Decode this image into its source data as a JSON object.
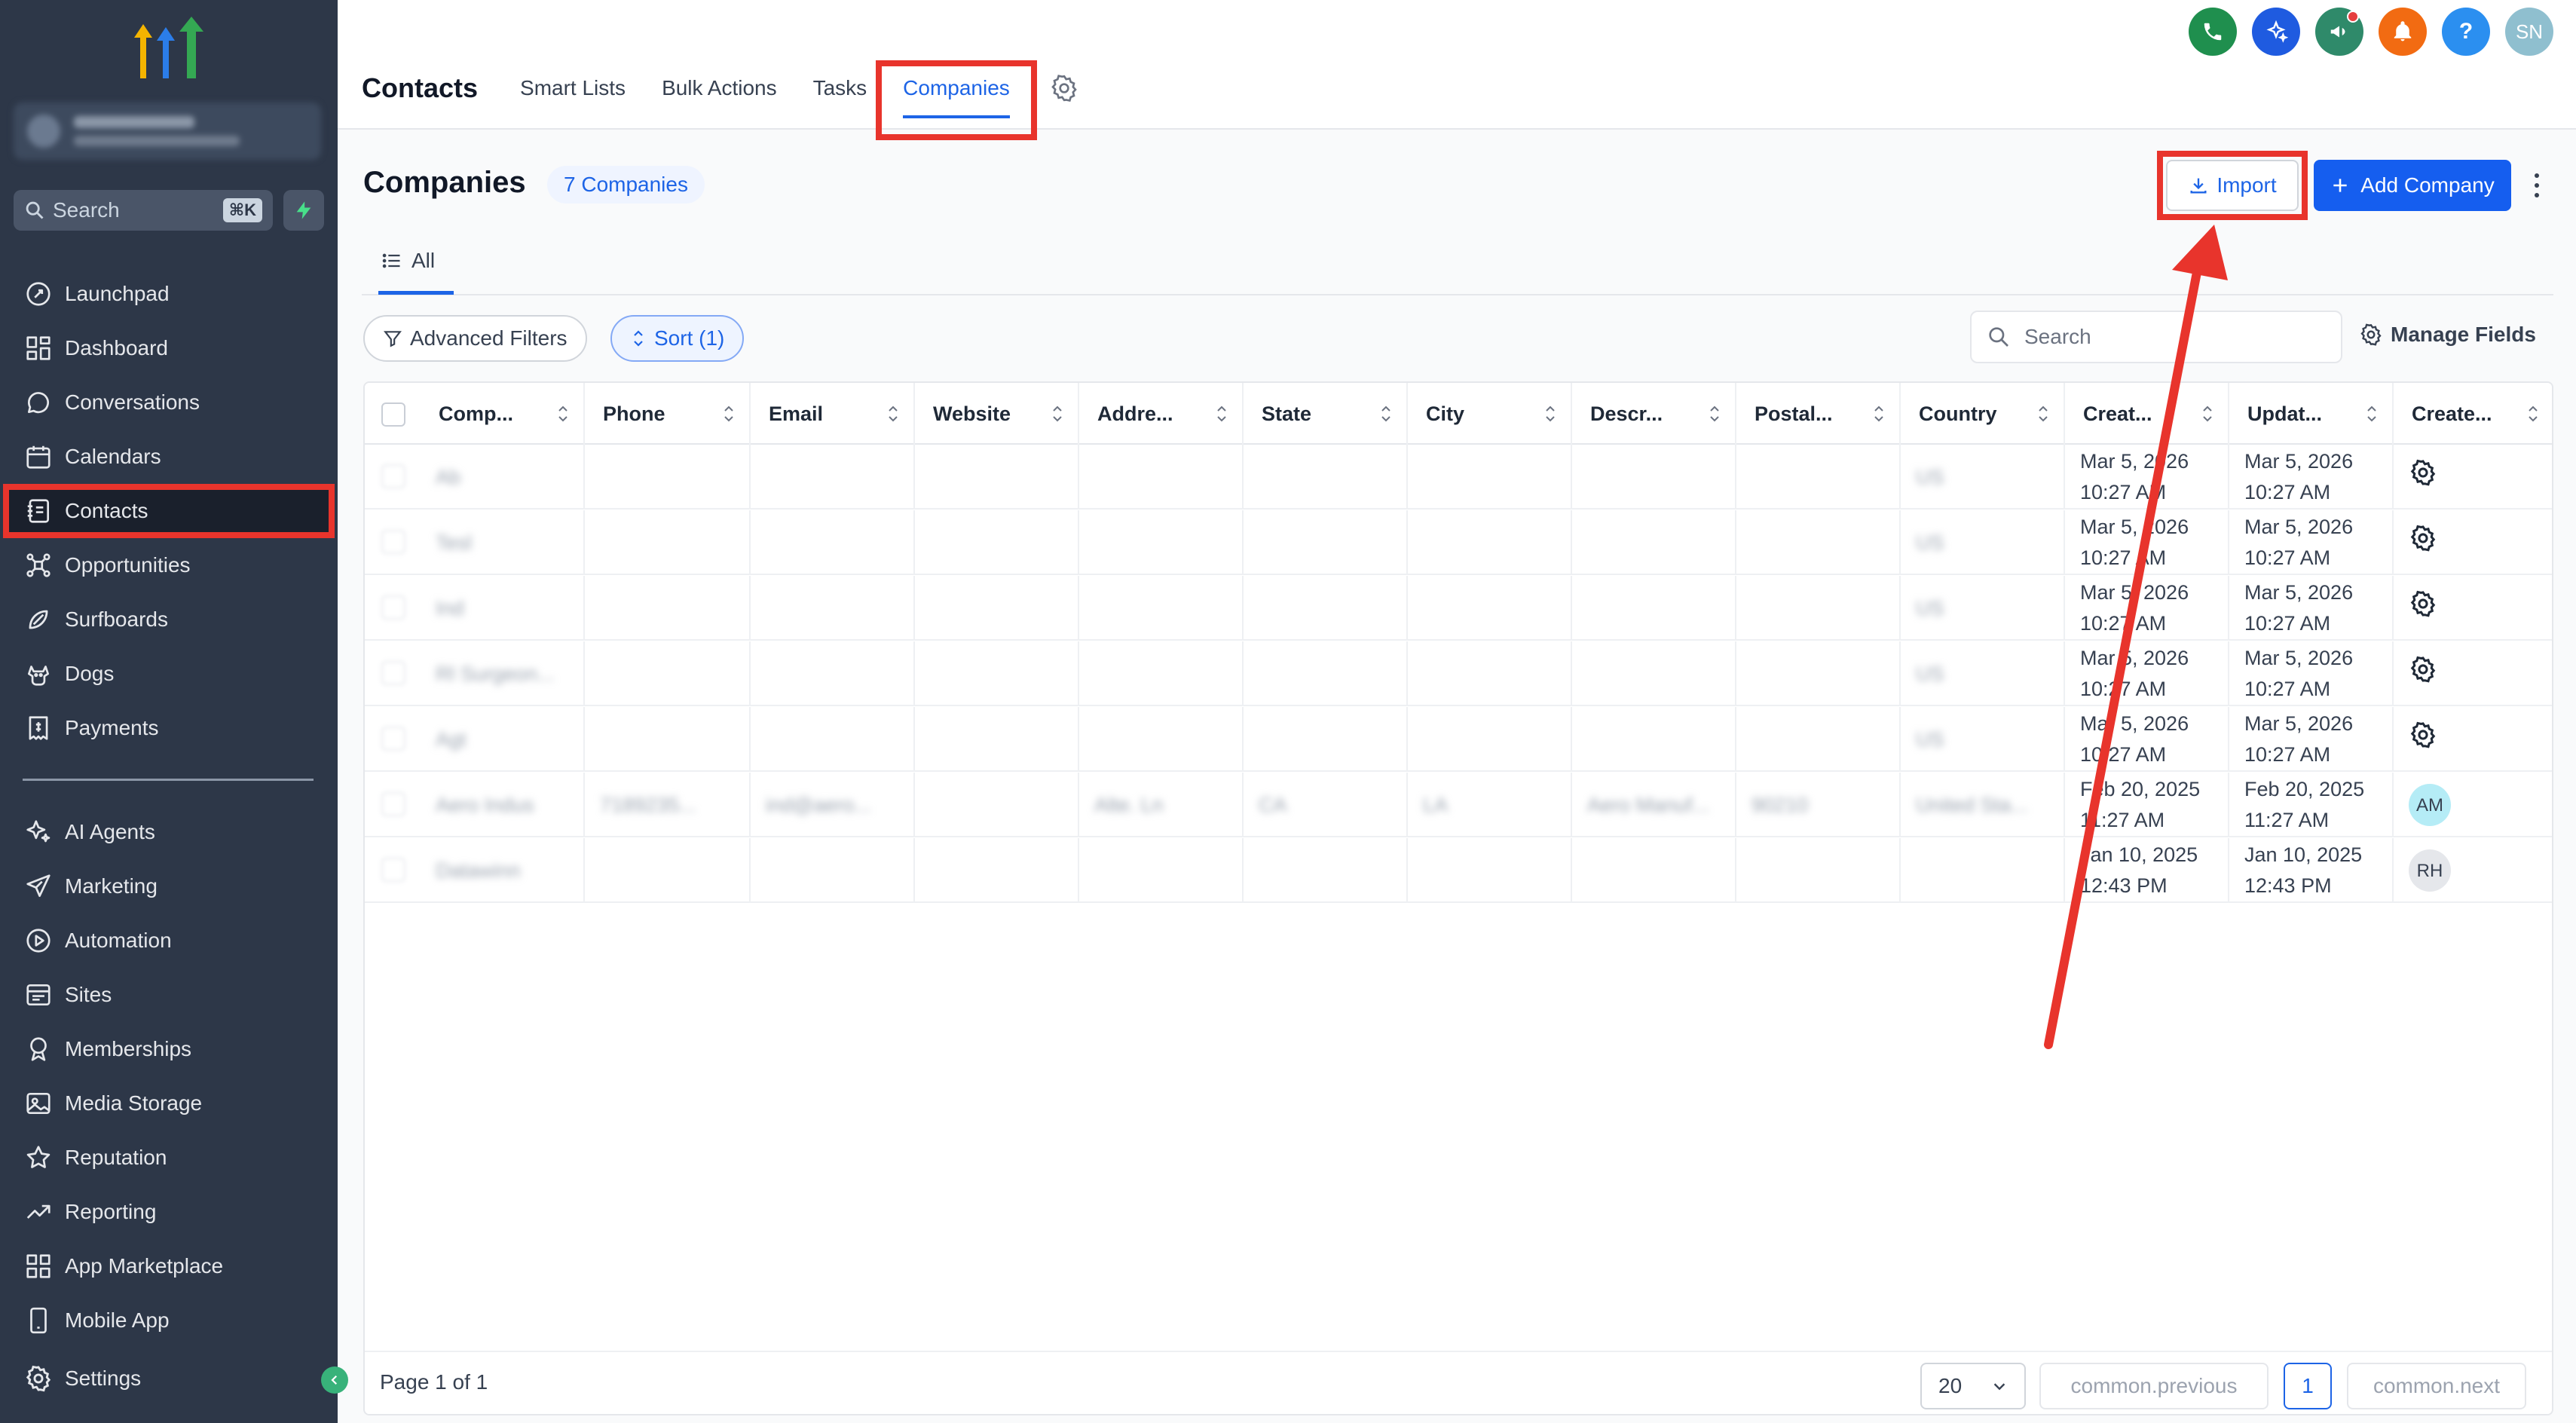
{
  "sidebar": {
    "search_placeholder": "Search",
    "search_shortcut": "⌘K",
    "items_top": [
      {
        "label": "Launchpad",
        "icon": "rocket-icon"
      },
      {
        "label": "Dashboard",
        "icon": "grid-icon"
      },
      {
        "label": "Conversations",
        "icon": "chat-icon"
      },
      {
        "label": "Calendars",
        "icon": "calendar-icon"
      },
      {
        "label": "Contacts",
        "icon": "contact-book-icon",
        "active": true
      },
      {
        "label": "Opportunities",
        "icon": "network-icon"
      },
      {
        "label": "Surfboards",
        "icon": "surfboard-icon"
      },
      {
        "label": "Dogs",
        "icon": "dog-icon"
      },
      {
        "label": "Payments",
        "icon": "receipt-icon"
      }
    ],
    "items_bottom": [
      {
        "label": "AI Agents",
        "icon": "sparkle-icon"
      },
      {
        "label": "Marketing",
        "icon": "send-icon"
      },
      {
        "label": "Automation",
        "icon": "play-circle-icon"
      },
      {
        "label": "Sites",
        "icon": "browser-icon"
      },
      {
        "label": "Memberships",
        "icon": "badge-icon"
      },
      {
        "label": "Media Storage",
        "icon": "image-icon"
      },
      {
        "label": "Reputation",
        "icon": "star-icon"
      },
      {
        "label": "Reporting",
        "icon": "trend-icon"
      },
      {
        "label": "App Marketplace",
        "icon": "apps-icon"
      },
      {
        "label": "Mobile App",
        "icon": "phone-outline-icon"
      }
    ],
    "settings_label": "Settings"
  },
  "topbar": {
    "title": "Contacts",
    "tabs": [
      "Smart Lists",
      "Bulk Actions",
      "Tasks",
      "Companies"
    ],
    "active_tab": "Companies",
    "user_initials": "SN"
  },
  "page": {
    "title": "Companies",
    "count_label": "7 Companies",
    "import_label": "Import",
    "add_label": "Add Company",
    "view_tab": "All",
    "advanced_filters_label": "Advanced Filters",
    "sort_label": "Sort (1)",
    "search_placeholder": "Search",
    "manage_fields_label": "Manage Fields"
  },
  "table": {
    "columns": [
      "Comp...",
      "Phone",
      "Email",
      "Website",
      "Addre...",
      "State",
      "City",
      "Descr...",
      "Postal...",
      "Country",
      "Creat...",
      "Updat...",
      "Create..."
    ],
    "rows": [
      {
        "company": "Ab",
        "phone": "",
        "email": "",
        "website": "",
        "address": "",
        "state": "",
        "city": "",
        "description": "",
        "postal": "",
        "country": "US",
        "created_date": "Mar 5, 2026",
        "created_time": "10:27 AM",
        "updated_date": "Mar 5, 2026",
        "updated_time": "10:27 AM",
        "creator": "gear"
      },
      {
        "company": "Tesl",
        "phone": "",
        "email": "",
        "website": "",
        "address": "",
        "state": "",
        "city": "",
        "description": "",
        "postal": "",
        "country": "US",
        "created_date": "Mar 5, 2026",
        "created_time": "10:27 AM",
        "updated_date": "Mar 5, 2026",
        "updated_time": "10:27 AM",
        "creator": "gear"
      },
      {
        "company": "Ind",
        "phone": "",
        "email": "",
        "website": "",
        "address": "",
        "state": "",
        "city": "",
        "description": "",
        "postal": "",
        "country": "US",
        "created_date": "Mar 5, 2026",
        "created_time": "10:27 AM",
        "updated_date": "Mar 5, 2026",
        "updated_time": "10:27 AM",
        "creator": "gear"
      },
      {
        "company": "Rl Surgeon...",
        "phone": "",
        "email": "",
        "website": "",
        "address": "",
        "state": "",
        "city": "",
        "description": "",
        "postal": "",
        "country": "US",
        "created_date": "Mar 5, 2026",
        "created_time": "10:27 AM",
        "updated_date": "Mar 5, 2026",
        "updated_time": "10:27 AM",
        "creator": "gear"
      },
      {
        "company": "Agt",
        "phone": "",
        "email": "",
        "website": "",
        "address": "",
        "state": "",
        "city": "",
        "description": "",
        "postal": "",
        "country": "US",
        "created_date": "Mar 5, 2026",
        "created_time": "10:27 AM",
        "updated_date": "Mar 5, 2026",
        "updated_time": "10:27 AM",
        "creator": "gear"
      },
      {
        "company": "Aero Indus",
        "phone": "7189235...",
        "email": "ind@aero...",
        "website": "",
        "address": "Alte. Ln",
        "state": "CA",
        "city": "LA",
        "description": "Aero Manuf...",
        "postal": "90210",
        "country": "United Sta...",
        "created_date": "Feb 20, 2025",
        "created_time": "11:27 AM",
        "updated_date": "Feb 20, 2025",
        "updated_time": "11:27 AM",
        "creator": "AM"
      },
      {
        "company": "Datawinn",
        "phone": "",
        "email": "",
        "website": "",
        "address": "",
        "state": "",
        "city": "",
        "description": "",
        "postal": "",
        "country": "",
        "created_date": "Jan 10, 2025",
        "created_time": "12:43 PM",
        "updated_date": "Jan 10, 2025",
        "updated_time": "12:43 PM",
        "creator": "RH"
      }
    ]
  },
  "footer": {
    "page_info": "Page 1 of 1",
    "per_page": "20",
    "prev_label": "common.previous",
    "current_page": "1",
    "next_label": "common.next"
  },
  "colors": {
    "sidebar_bg": "#2d3748",
    "accent": "#155eef",
    "highlight": "#e8342c"
  }
}
